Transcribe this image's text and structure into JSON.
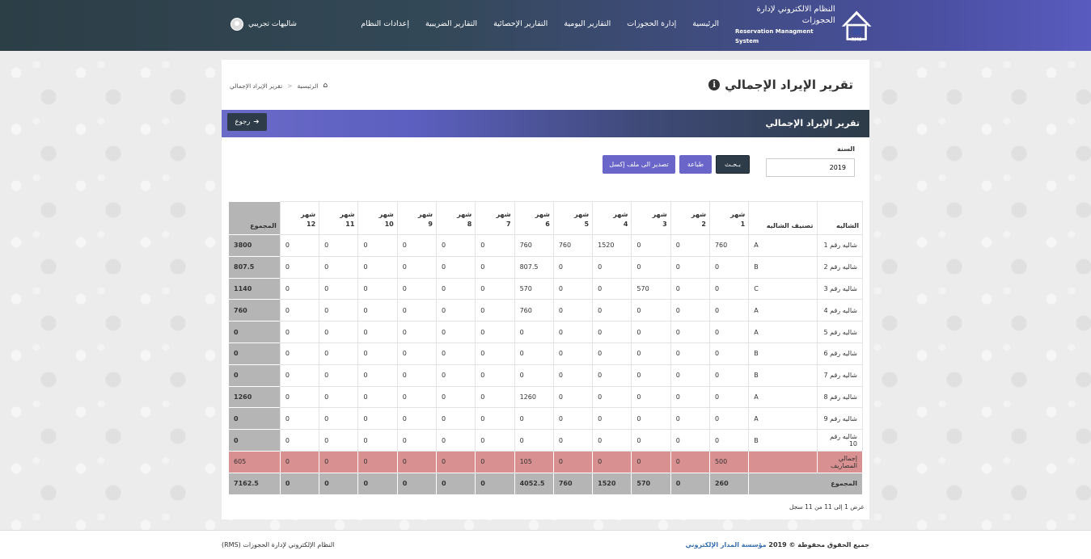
{
  "header": {
    "logo_title": "النظام الالكتروني لإدارة الحجوزات",
    "logo_subtitle": "Reservation Managment System",
    "logo_badge": "RMS",
    "nav": [
      "الرئيسية",
      "إدارة الحجوزات",
      "التقارير اليومية",
      "التقارير الإحصائية",
      "التقارير الضريبية",
      "إعدادات النظام"
    ],
    "user_name": "شاليهات تجريبي"
  },
  "page": {
    "title": "تقرير الإيراد الإجمالي",
    "breadcrumb": [
      "الرئيسية",
      "تقرير الإيراد الإجمالي"
    ],
    "section_title": "تقرير الإيراد الإجمالي",
    "back_label": "رجوع"
  },
  "filter": {
    "year_label": "السنة",
    "year_value": "2019",
    "search_label": "بـحـث",
    "print_label": "طباعة",
    "excel_label": "تصدير الى ملف إكسل"
  },
  "table": {
    "headers": {
      "chalet": "الشاليه",
      "class": "تصنيف الشاليه",
      "month_word": "شهر",
      "months": [
        "1",
        "2",
        "3",
        "4",
        "5",
        "6",
        "7",
        "8",
        "9",
        "10",
        "11",
        "12"
      ],
      "total": "المجموع"
    },
    "rows": [
      {
        "name": "شاليه رقم 1",
        "class": "A",
        "months": [
          "760",
          "0",
          "0",
          "1520",
          "760",
          "760",
          "0",
          "0",
          "0",
          "0",
          "0",
          "0"
        ],
        "total": "3800"
      },
      {
        "name": "شاليه رقم 2",
        "class": "B",
        "months": [
          "0",
          "0",
          "0",
          "0",
          "0",
          "807.5",
          "0",
          "0",
          "0",
          "0",
          "0",
          "0"
        ],
        "total": "807.5"
      },
      {
        "name": "شاليه رقم 3",
        "class": "C",
        "months": [
          "0",
          "0",
          "570",
          "0",
          "0",
          "570",
          "0",
          "0",
          "0",
          "0",
          "0",
          "0"
        ],
        "total": "1140"
      },
      {
        "name": "شاليه رقم 4",
        "class": "A",
        "months": [
          "0",
          "0",
          "0",
          "0",
          "0",
          "760",
          "0",
          "0",
          "0",
          "0",
          "0",
          "0"
        ],
        "total": "760"
      },
      {
        "name": "شاليه رقم 5",
        "class": "A",
        "months": [
          "0",
          "0",
          "0",
          "0",
          "0",
          "0",
          "0",
          "0",
          "0",
          "0",
          "0",
          "0"
        ],
        "total": "0"
      },
      {
        "name": "شاليه رقم 6",
        "class": "B",
        "months": [
          "0",
          "0",
          "0",
          "0",
          "0",
          "0",
          "0",
          "0",
          "0",
          "0",
          "0",
          "0"
        ],
        "total": "0"
      },
      {
        "name": "شاليه رقم 7",
        "class": "B",
        "months": [
          "0",
          "0",
          "0",
          "0",
          "0",
          "0",
          "0",
          "0",
          "0",
          "0",
          "0",
          "0"
        ],
        "total": "0"
      },
      {
        "name": "شاليه رقم 8",
        "class": "A",
        "months": [
          "0",
          "0",
          "0",
          "0",
          "0",
          "1260",
          "0",
          "0",
          "0",
          "0",
          "0",
          "0"
        ],
        "total": "1260"
      },
      {
        "name": "شاليه رقم 9",
        "class": "A",
        "months": [
          "0",
          "0",
          "0",
          "0",
          "0",
          "0",
          "0",
          "0",
          "0",
          "0",
          "0",
          "0"
        ],
        "total": "0"
      },
      {
        "name": "شاليه رقم 10",
        "class": "B",
        "months": [
          "0",
          "0",
          "0",
          "0",
          "0",
          "0",
          "0",
          "0",
          "0",
          "0",
          "0",
          "0"
        ],
        "total": "0"
      }
    ],
    "expenses": {
      "name": "إجمالي المصاريف",
      "class": "",
      "months": [
        "500",
        "0",
        "0",
        "0",
        "0",
        "105",
        "0",
        "0",
        "0",
        "0",
        "0",
        "0"
      ],
      "total": "605"
    },
    "totals": {
      "name": "المجموع",
      "months": [
        "260",
        "0",
        "570",
        "1520",
        "760",
        "4052.5",
        "0",
        "0",
        "0",
        "0",
        "0",
        "0"
      ],
      "total": "7162.5"
    }
  },
  "records_info": "عرض 1 إلى 11 من 11 سجل",
  "footer": {
    "rights_prefix": "جميع الحقوق محفوظة © 2019",
    "company": "مؤسسة المدار الإلكتروني",
    "system_name": "النظام الإلكتروني لإدارة الحجوزات (RMS)"
  },
  "colors": {
    "header_dark": "#2c3e46",
    "header_purple": "#5a5bbf",
    "button_purple": "#6a65c8",
    "expenses_row": "#d99090",
    "totals_grey": "#b5b5b5"
  },
  "icons": [
    "house-logo-icon",
    "user-avatar-icon",
    "info-icon",
    "home-icon",
    "arrow-right-icon"
  ]
}
